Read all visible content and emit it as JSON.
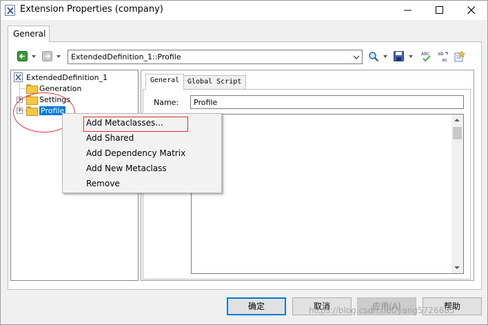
{
  "window": {
    "title": "Extension Properties (company)"
  },
  "main_tab": {
    "label": "General"
  },
  "toolbar": {
    "path_value": "ExtendedDefinition_1::Profile",
    "icons": [
      "back-arrow-icon",
      "forward-arrow-icon",
      "find-icon",
      "save-icon",
      "spell-check-icon",
      "replace-icon",
      "properties-icon"
    ]
  },
  "tree": {
    "root": "ExtendedDefinition_1",
    "items": [
      {
        "label": "Generation"
      },
      {
        "label": "Settings"
      },
      {
        "label": "Profile"
      }
    ]
  },
  "inner_tabs": [
    {
      "label": "General"
    },
    {
      "label": "Global Script"
    }
  ],
  "form": {
    "name_label": "Name:",
    "name_value": "Profile"
  },
  "context_menu": {
    "items": [
      {
        "label": "Add Metaclasses..."
      },
      {
        "label": "Add Shared"
      },
      {
        "label": "Add Dependency Matrix"
      },
      {
        "label": "Add New Metaclass"
      },
      {
        "label": "Remove"
      }
    ]
  },
  "buttons": {
    "ok": "确定",
    "cancel": "取消",
    "apply": "应用(A)",
    "help": "帮助"
  },
  "watermark": "https://blog.csdn.net/yang5726685",
  "colors": {
    "selection": "#0078d7",
    "annotation": "#e03030",
    "folder": "#f5c842"
  }
}
